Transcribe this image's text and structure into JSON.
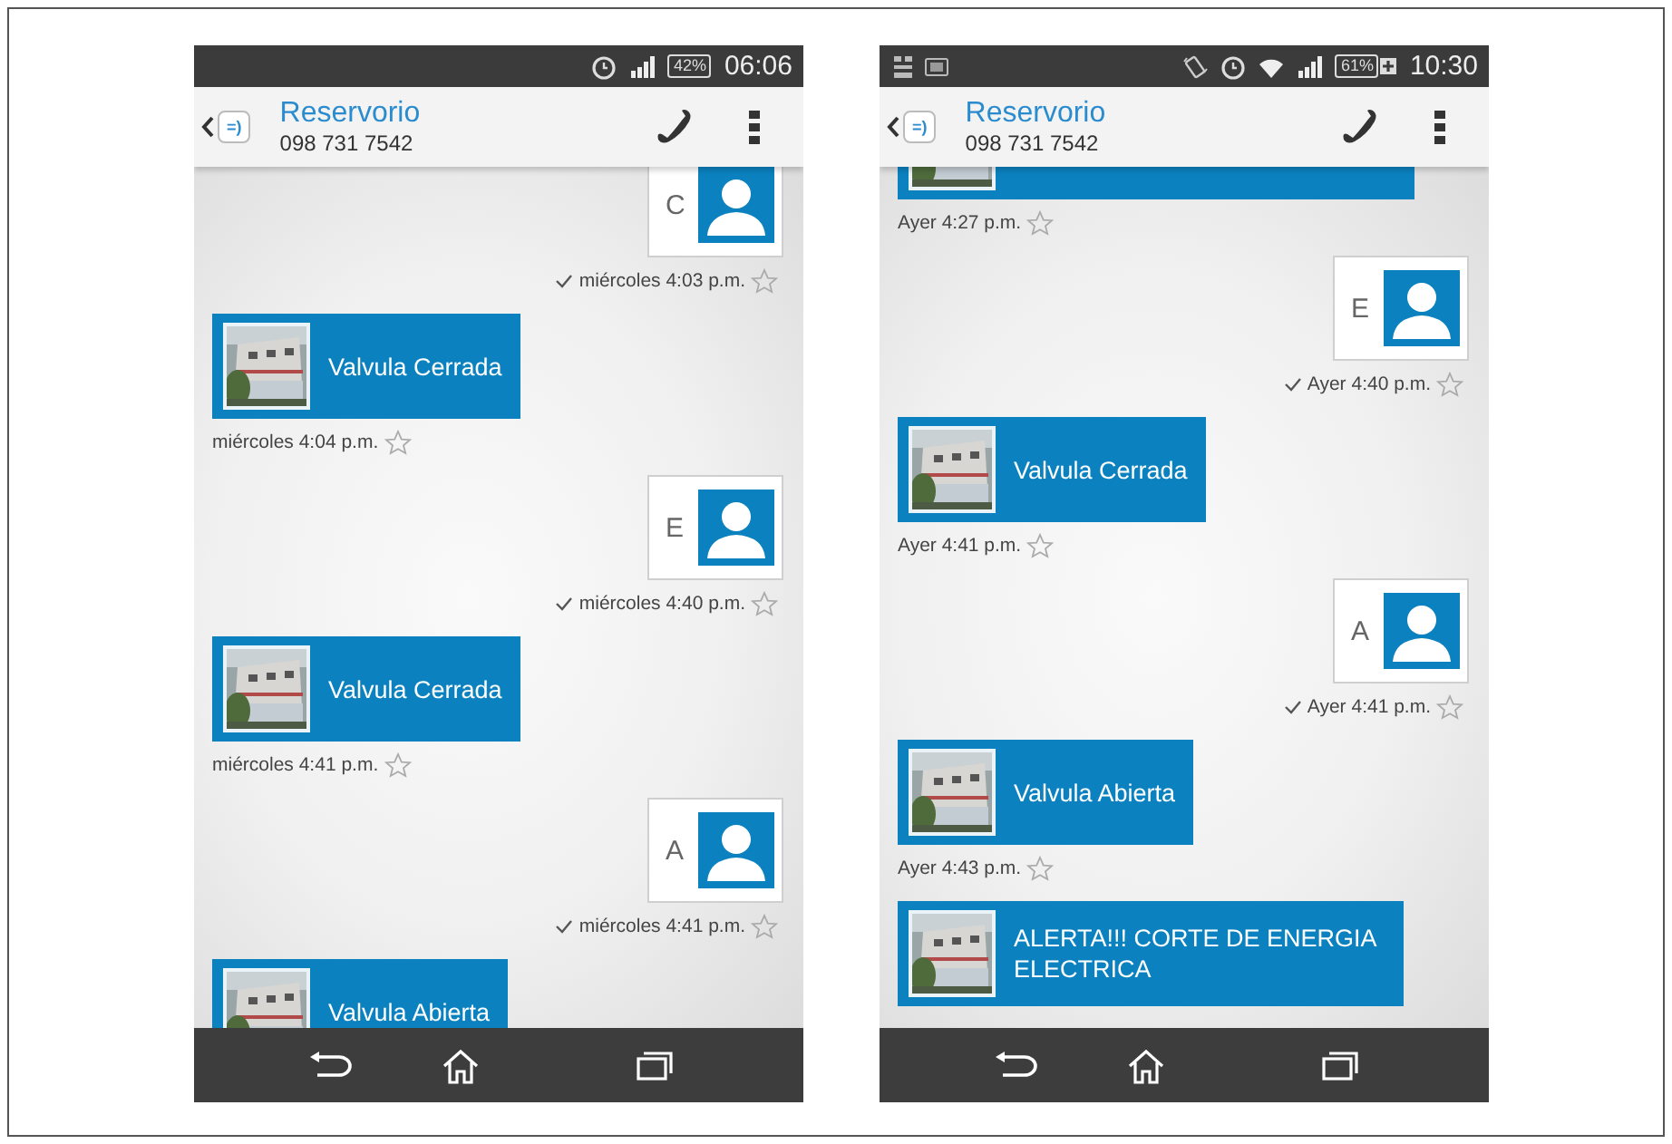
{
  "phones": [
    {
      "status_bar": {
        "right_icons": [
          {
            "kind": "alarm"
          },
          {
            "kind": "signal"
          }
        ],
        "battery": {
          "text": "42%",
          "charging": false
        },
        "time": "06:06"
      },
      "contact": {
        "logo": "=)",
        "name": "Reservorio",
        "number": "098 731 7542"
      },
      "messages": [
        {
          "kind": "contact_card",
          "letter": "C",
          "timestamp": "miércoles 4:03 p.m.",
          "delivered": true,
          "starred": false
        },
        {
          "kind": "image_text",
          "text": "Valvula Cerrada",
          "timestamp": "miércoles 4:04 p.m.",
          "delivered": false,
          "starred": false
        },
        {
          "kind": "contact_card",
          "letter": "E",
          "timestamp": "miércoles 4:40 p.m.",
          "delivered": true,
          "starred": false
        },
        {
          "kind": "image_text",
          "text": "Valvula Cerrada",
          "timestamp": "miércoles 4:41 p.m.",
          "delivered": false,
          "starred": false
        },
        {
          "kind": "contact_card",
          "letter": "A",
          "timestamp": "miércoles 4:41 p.m.",
          "delivered": true,
          "starred": false
        },
        {
          "kind": "image_text",
          "text": "Valvula Abierta"
        }
      ]
    },
    {
      "status_bar": {
        "left_icons": [
          {
            "kind": "keypad"
          },
          {
            "kind": "tablet"
          }
        ],
        "right_icons": [
          {
            "kind": "vibrate"
          },
          {
            "kind": "alarm"
          },
          {
            "kind": "wifi"
          },
          {
            "kind": "signal"
          }
        ],
        "battery": {
          "text": "61%",
          "charging": true
        },
        "time": "10:30"
      },
      "contact": {
        "logo": "=)",
        "name": "Reservorio",
        "number": "098 731 7542"
      },
      "messages": [
        {
          "kind": "image_text",
          "timestamp": "Ayer 4:27 p.m.",
          "delivered": false,
          "starred": false
        },
        {
          "kind": "contact_card",
          "letter": "E",
          "timestamp": "Ayer 4:40 p.m.",
          "delivered": true,
          "starred": false
        },
        {
          "kind": "image_text",
          "text": "Valvula Cerrada",
          "timestamp": "Ayer 4:41 p.m.",
          "delivered": false,
          "starred": false
        },
        {
          "kind": "contact_card",
          "letter": "A",
          "timestamp": "Ayer 4:41 p.m.",
          "delivered": true,
          "starred": false
        },
        {
          "kind": "image_text",
          "text": "Valvula Abierta",
          "timestamp": "Ayer 4:43 p.m.",
          "delivered": false,
          "starred": false
        },
        {
          "kind": "image_text",
          "text": "ALERTA!!! CORTE DE ENERGIA ELECTRICA"
        }
      ]
    }
  ]
}
